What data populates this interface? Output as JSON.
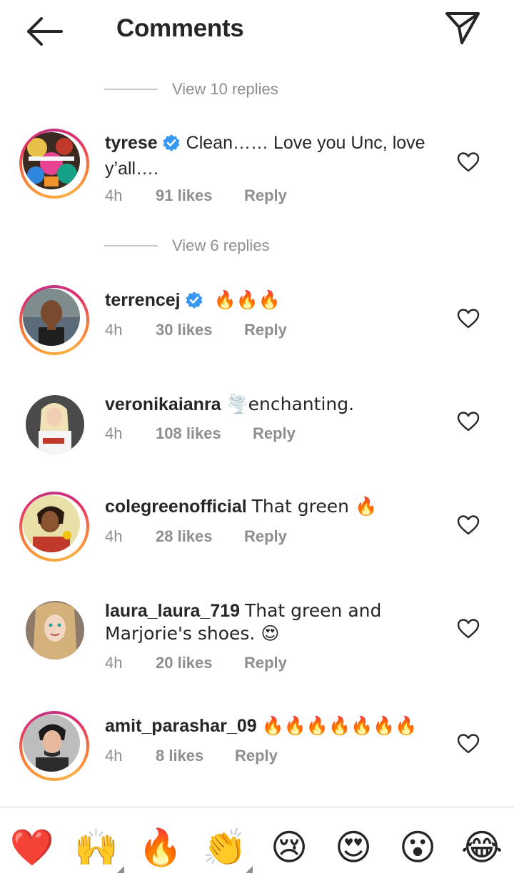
{
  "header": {
    "title": "Comments",
    "back_icon": "arrow-left-icon",
    "send_icon": "paper-plane-icon"
  },
  "view_replies": [
    {
      "label": "View 10 replies"
    },
    {
      "label": "View 6 replies"
    }
  ],
  "comments": [
    {
      "username": "tyrese",
      "verified": true,
      "text": "Clean…… Love you Unc, love y’all….",
      "time": "4h",
      "likes": "91 likes",
      "reply": "Reply",
      "has_story_ring": true
    },
    {
      "username": "terrencej",
      "verified": true,
      "text": "🔥🔥🔥",
      "time": "4h",
      "likes": "30 likes",
      "reply": "Reply",
      "has_story_ring": true
    },
    {
      "username": "veronikaianra",
      "verified": false,
      "text": "🌪️enchanting.",
      "time": "4h",
      "likes": "108 likes",
      "reply": "Reply",
      "has_story_ring": false
    },
    {
      "username": "colegreenofficial",
      "verified": false,
      "text": "That green 🔥",
      "time": "4h",
      "likes": "28 likes",
      "reply": "Reply",
      "has_story_ring": true
    },
    {
      "username": "laura_laura_719",
      "verified": false,
      "text": "That green and Marjorie's shoes. 😍",
      "time": "4h",
      "likes": "20 likes",
      "reply": "Reply",
      "has_story_ring": false
    },
    {
      "username": "amit_parashar_09",
      "verified": false,
      "text": "🔥🔥🔥🔥🔥🔥🔥",
      "time": "4h",
      "likes": "8 likes",
      "reply": "Reply",
      "has_story_ring": true
    }
  ],
  "reactions": [
    {
      "emoji": "❤️",
      "name": "red-heart-emoji"
    },
    {
      "emoji": "🙌",
      "name": "raising-hands-emoji"
    },
    {
      "emoji": "🔥",
      "name": "fire-emoji"
    },
    {
      "emoji": "👏",
      "name": "clapping-hands-emoji"
    },
    {
      "emoji": "😢",
      "name": "crying-face-emoji"
    },
    {
      "emoji": "😍",
      "name": "heart-eyes-emoji"
    },
    {
      "emoji": "😮",
      "name": "surprised-face-emoji"
    },
    {
      "emoji": "😂",
      "name": "tears-of-joy-emoji"
    }
  ],
  "colors": {
    "text": "#262626",
    "secondary": "#8e8e8e",
    "verified": "#3897f0",
    "divider": "#dbdbdb"
  }
}
